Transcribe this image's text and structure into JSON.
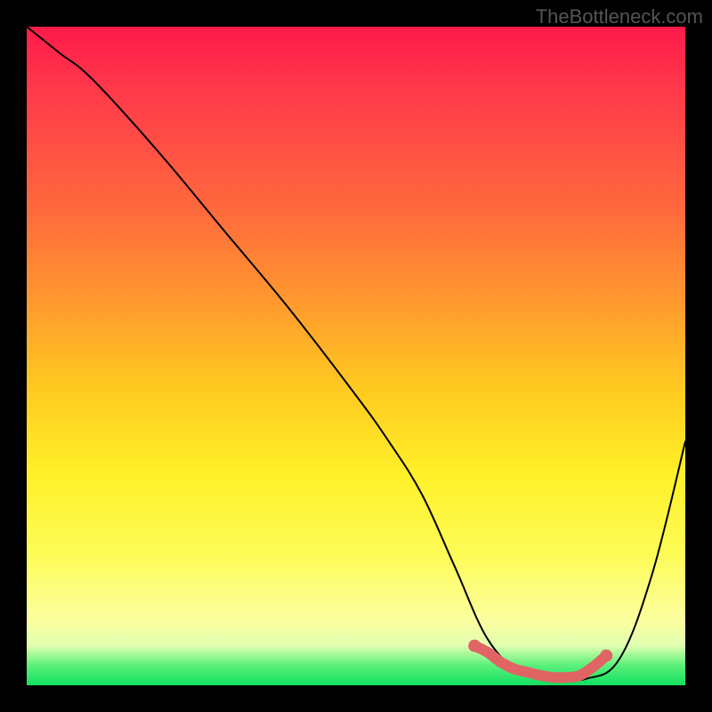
{
  "watermark": "TheBottleneck.com",
  "chart_data": {
    "type": "line",
    "title": "",
    "xlabel": "",
    "ylabel": "",
    "xlim": [
      0,
      100
    ],
    "ylim": [
      0,
      100
    ],
    "series": [
      {
        "name": "curve",
        "x": [
          0,
          5,
          10,
          20,
          30,
          40,
          50,
          55,
          60,
          65,
          70,
          75,
          80,
          85,
          90,
          95,
          100
        ],
        "values": [
          100,
          96,
          92,
          81,
          69,
          57,
          44,
          37,
          29,
          18,
          7,
          2,
          1,
          1,
          4,
          17,
          37
        ]
      }
    ],
    "highlight": {
      "name": "near-zero-band",
      "color": "#e06464",
      "x": [
        68,
        70,
        72,
        74,
        76,
        78,
        80,
        82,
        84,
        86,
        88
      ],
      "values": [
        6,
        5,
        3.5,
        2.5,
        2,
        1.5,
        1.2,
        1.2,
        1.5,
        2.8,
        4.5
      ]
    }
  }
}
